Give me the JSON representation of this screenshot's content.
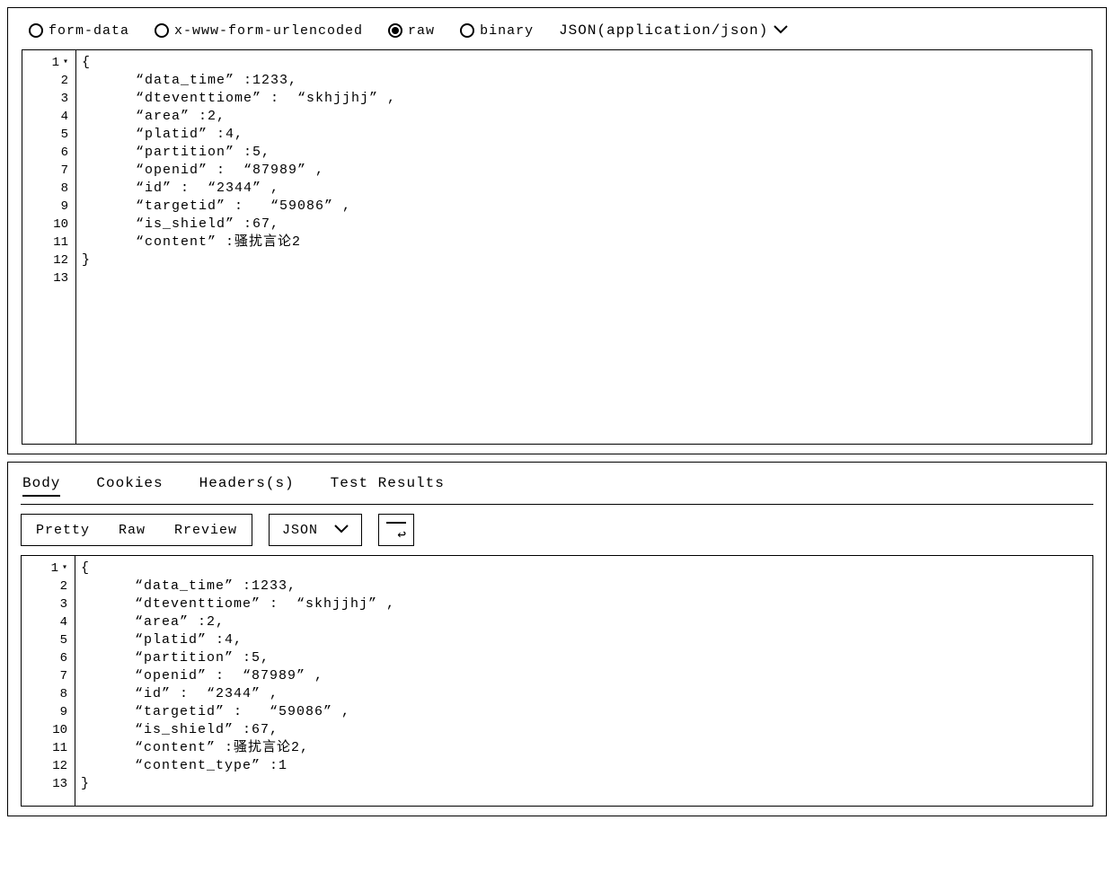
{
  "request": {
    "body_types": {
      "form_data": "form-data",
      "urlencoded": "x-www-form-urlencoded",
      "raw": "raw",
      "binary": "binary"
    },
    "selected_body_type": "raw",
    "content_type_label": "JSON(application/json)",
    "editor_lines": [
      "{",
      "      “data_time” :1233,",
      "      “dteventtiome” :  “skhjjhj” ,",
      "      “area” :2,",
      "      “platid” :4,",
      "      “partition” :5,",
      "      “openid” :  “87989” ,",
      "      “id” :  “2344” ,",
      "      “targetid” :   “59086” ,",
      "      “is_shield” :67,",
      "      “content” :骚扰言论2",
      "}",
      ""
    ]
  },
  "response": {
    "tabs": {
      "body": "Body",
      "cookies": "Cookies",
      "headers": "Headers(s)",
      "test_results": "Test Results"
    },
    "view_modes": {
      "pretty": "Pretty",
      "raw": "Raw",
      "preview": "Rreview"
    },
    "format_label": "JSON",
    "editor_lines": [
      "{",
      "      “data_time” :1233,",
      "      “dteventtiome” :  “skhjjhj” ,",
      "      “area” :2,",
      "      “platid” :4,",
      "      “partition” :5,",
      "      “openid” :  “87989” ,",
      "      “id” :  “2344” ,",
      "      “targetid” :   “59086” ,",
      "      “is_shield” :67,",
      "      “content” :骚扰言论2,",
      "      “content_type” :1",
      "}"
    ]
  }
}
